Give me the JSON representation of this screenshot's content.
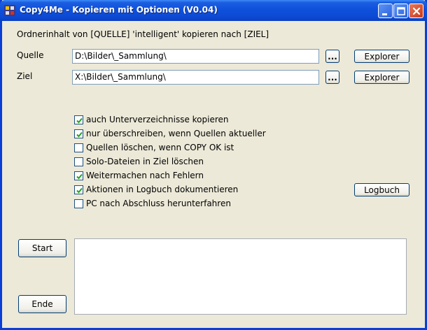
{
  "window": {
    "title": "Copy4Me - Kopieren mit Optionen (V0.04)"
  },
  "heading": "Ordnerinhalt von [QUELLE] 'intelligent' kopieren nach [ZIEL]",
  "source": {
    "label": "Quelle",
    "value": "D:\\Bilder\\_Sammlung\\",
    "browse_label": "...",
    "explorer_label": "Explorer"
  },
  "target": {
    "label": "Ziel",
    "value": "X:\\Bilder\\_Sammlung\\",
    "browse_label": "...",
    "explorer_label": "Explorer"
  },
  "options": [
    {
      "label": "auch Unterverzeichnisse kopieren",
      "checked": true
    },
    {
      "label": "nur überschreiben, wenn Quellen aktueller",
      "checked": true
    },
    {
      "label": "Quellen löschen, wenn COPY OK ist",
      "checked": false
    },
    {
      "label": "Solo-Dateien in Ziel löschen",
      "checked": false
    },
    {
      "label": "Weitermachen nach Fehlern",
      "checked": true
    },
    {
      "label": "Aktionen in Logbuch dokumentieren",
      "checked": true
    },
    {
      "label": "PC nach Abschluss herunterfahren",
      "checked": false
    }
  ],
  "logbook_button": "Logbuch",
  "start_button": "Start",
  "end_button": "Ende",
  "log_output": ""
}
